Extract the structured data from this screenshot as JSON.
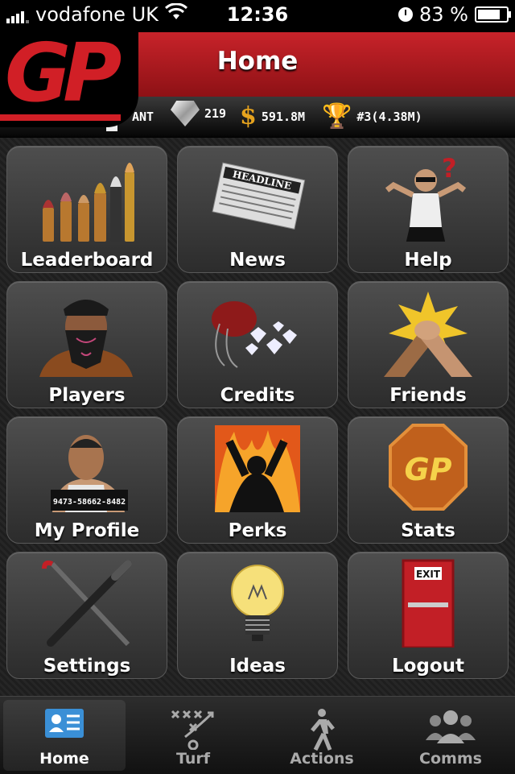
{
  "status_bar": {
    "carrier": "vodafone UK",
    "time": "12:36",
    "battery": "83 %",
    "battery_level": 0.83
  },
  "header": {
    "title": "Home",
    "logo_text": "GP"
  },
  "info_bar": {
    "player_name": "ANT",
    "diamonds": "219",
    "money": "591.8M",
    "rank": "#3(4.38M)"
  },
  "tiles": [
    {
      "label": "Leaderboard",
      "icon": "bullets-icon"
    },
    {
      "label": "News",
      "icon": "newspaper-icon",
      "art_text": "HEADLINE"
    },
    {
      "label": "Help",
      "icon": "confused-man-icon"
    },
    {
      "label": "Players",
      "icon": "bandana-gangster-icon"
    },
    {
      "label": "Credits",
      "icon": "diamond-bag-icon"
    },
    {
      "label": "Friends",
      "icon": "handshake-icon"
    },
    {
      "label": "My Profile",
      "icon": "mugshot-icon",
      "art_text": "9473-58662-8482"
    },
    {
      "label": "Perks",
      "icon": "fire-man-icon"
    },
    {
      "label": "Stats",
      "icon": "gp-badge-icon",
      "art_text": "GP"
    },
    {
      "label": "Settings",
      "icon": "crowbar-bat-icon"
    },
    {
      "label": "Ideas",
      "icon": "lightbulb-icon"
    },
    {
      "label": "Logout",
      "icon": "exit-door-icon",
      "art_text": "EXIT"
    }
  ],
  "tab_bar": [
    {
      "label": "Home",
      "icon": "profile-card-icon",
      "active": true
    },
    {
      "label": "Turf",
      "icon": "tactics-icon",
      "active": false
    },
    {
      "label": "Actions",
      "icon": "walking-man-icon",
      "active": false
    },
    {
      "label": "Comms",
      "icon": "group-icon",
      "active": false
    }
  ],
  "colors": {
    "brand_red": "#c8232a",
    "tab_blue": "#3a8fd6"
  }
}
